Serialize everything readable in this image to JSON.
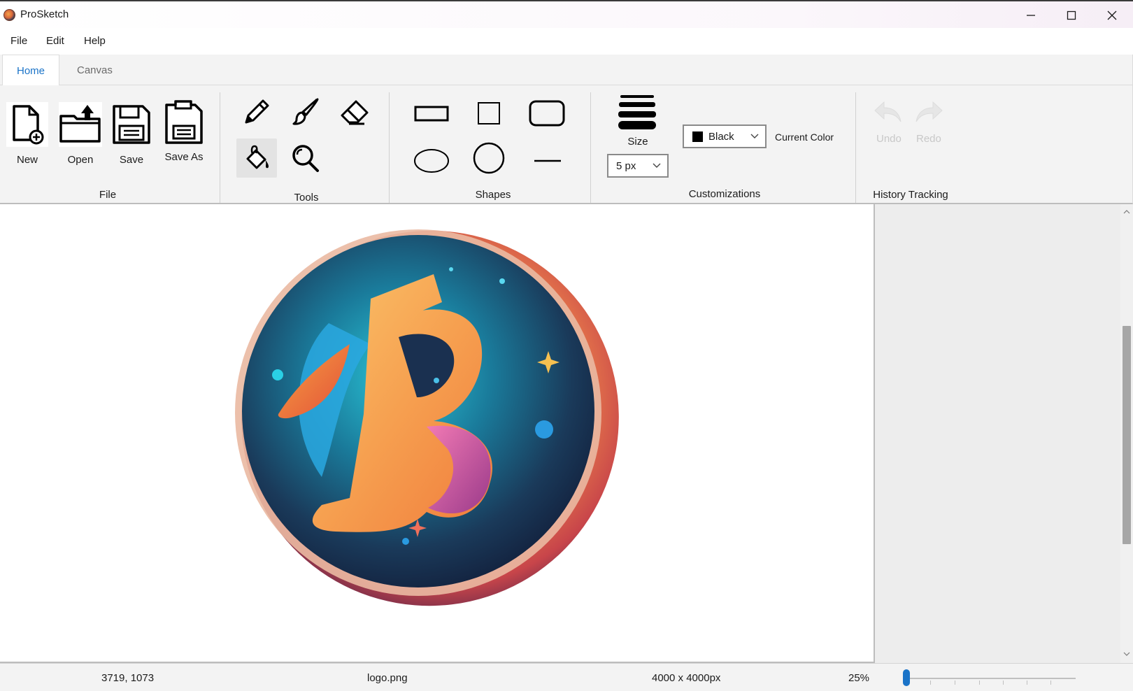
{
  "window": {
    "title": "ProSketch"
  },
  "menu": {
    "items": [
      "File",
      "Edit",
      "Help"
    ]
  },
  "tabs": [
    {
      "label": "Home",
      "active": true
    },
    {
      "label": "Canvas",
      "active": false
    }
  ],
  "ribbon": {
    "file_group": {
      "label": "File",
      "buttons": {
        "new": "New",
        "open": "Open",
        "save": "Save",
        "save_as": "Save As"
      }
    },
    "tools_group": {
      "label": "Tools",
      "tools": [
        "pencil-icon",
        "brush-icon",
        "eraser-icon",
        "fill-bucket-icon",
        "magnifier-icon"
      ],
      "selected": "fill-bucket-icon"
    },
    "shapes_group": {
      "label": "Shapes",
      "shapes": [
        "rectangle-icon",
        "square-icon",
        "rounded-rectangle-icon",
        "ellipse-icon",
        "circle-icon",
        "line-icon"
      ]
    },
    "customizations_group": {
      "label": "Customizations",
      "size_label": "Size",
      "size_value": "5 px",
      "color_value": "Black",
      "color_swatch": "#000000",
      "current_color_label": "Current Color"
    },
    "history_group": {
      "label": "History Tracking",
      "undo": "Undo",
      "redo": "Redo",
      "enabled": false
    }
  },
  "canvas": {
    "image": "logo-image"
  },
  "status": {
    "cursor": "3719, 1073",
    "filename": "logo.png",
    "dimensions": "4000 x 4000px",
    "zoom": "25%",
    "zoom_fraction": 0.0
  },
  "colors": {
    "accent": "#1a73c8",
    "ribbon_bg": "#f3f3f3",
    "panel_bg": "#ededed"
  }
}
